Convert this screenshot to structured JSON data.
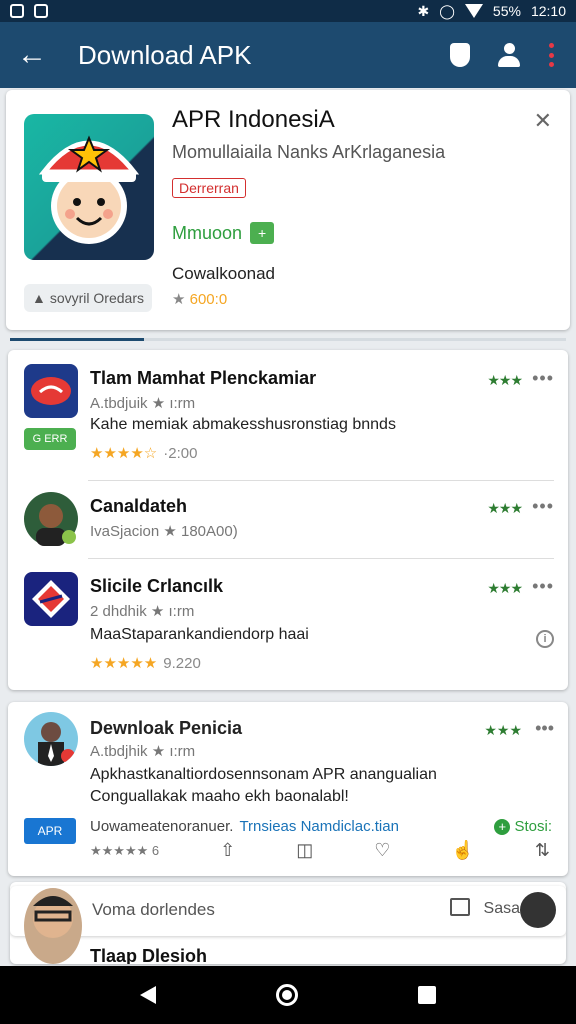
{
  "status_bar": {
    "battery": "55%",
    "time": "12:10"
  },
  "app_bar": {
    "title": "Download APK"
  },
  "hero": {
    "app_name": "APR IndonesiA",
    "subtitle": "Momullaiaila Nanks ArKrlaganesia",
    "tag": "Derrerran",
    "developer": "Mmuoon",
    "developer_icon": "+",
    "downloads_label": "Cowalkoonad",
    "rating": "600:0",
    "orders_chip": "sovyril Oredars"
  },
  "list": {
    "items": [
      {
        "title": "Tlam Mamhat Plenckamiar",
        "meta": "A.tbdjuik ★ ı:rm",
        "desc": "Kahe memiak abmakesshusronstiag bnnds",
        "stars": "★★★★☆",
        "rating_num": "·2:00",
        "badge": "G ERR",
        "grade": "★★★",
        "more": "•••"
      },
      {
        "title": "Canaldateh",
        "meta": "IvaSjacion ★ 180A00)",
        "grade": "★★★",
        "more": "•••"
      },
      {
        "title": "Slicile Crlancılk",
        "meta": "2 dhdhik ★ ı:rm",
        "desc": "MaaStaparankandiendorp haai",
        "stars": "★★★★★",
        "rating_num": "9.220",
        "grade": "★★★",
        "more": "•••",
        "info": "i"
      }
    ]
  },
  "post": {
    "title": "Dewnloak Penicia",
    "meta": "A.tbdjhik ★ ı:rm",
    "body_line1": "Apkhastkanaltiordosennsonam APR anangualian",
    "body_line2": "Conguallakak maaho ekh baonalabl!",
    "logo": "APR",
    "link_prefix": "Uowameatenoranuer.",
    "link": "Trnsieas Namdiclac.tian",
    "follow": "Stosi:",
    "grade": "★★★",
    "more": "•••",
    "mini_stars": "★★★★★ 6"
  },
  "comment": {
    "placeholder": "Voma dorlendes",
    "send": "Sasa",
    "next_title": "Tlaap Dlesioh"
  }
}
